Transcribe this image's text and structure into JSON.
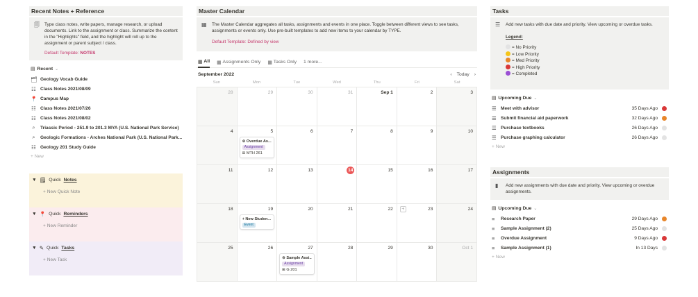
{
  "colors": {
    "none": "#e3e3e3",
    "low": "#f5c518",
    "med": "#e8862a",
    "high": "#d93838",
    "completed": "#9b4fd4",
    "today": "#eb5757",
    "notes_bg": "#fbf3db",
    "reminders_bg": "#fbecee",
    "tasks_bg": "#f1ecf7"
  },
  "left": {
    "title": "Recent Notes + Reference",
    "callout_icon": "note-icon",
    "callout_text": "Type class notes, write papers, manage research, or upload documents. Link to the assignment or class. Summarize the content in the \"Highlights\" field, and the highlight will roll up to the assignment or parent subject / class.",
    "template_label": "Default Template:",
    "template_value": "NOTES",
    "view": "Recent",
    "items": [
      {
        "icon": "card-icon",
        "label": "Geology Vocab Guide"
      },
      {
        "icon": "page-icon",
        "label": "Class Notes 2021/08/09"
      },
      {
        "icon": "pin-icon",
        "label": "Campus Map"
      },
      {
        "icon": "page-icon",
        "label": "Class Notes 2021/07/26"
      },
      {
        "icon": "page-icon",
        "label": "Class Notes 2021/08/02"
      },
      {
        "icon": "search-icon",
        "label": "Triassic Period - 251.9 to 201.3 MYA (U.S. National Park Service)"
      },
      {
        "icon": "search-icon",
        "label": "Geologic Formations - Arches National Park (U.S. National Park..."
      },
      {
        "icon": "page-icon",
        "label": "Geology 201 Study Guide"
      }
    ],
    "new_label": "New",
    "quick": [
      {
        "prefix": "Quick",
        "word": "Notes",
        "icon": "notepad-icon",
        "new": "New Quick Note"
      },
      {
        "prefix": "Quick",
        "word": "Reminders",
        "icon": "pin-icon",
        "new": "New Reminder"
      },
      {
        "prefix": "Quick",
        "word": "Tasks",
        "icon": "pencil-icon",
        "new": "New Task"
      }
    ]
  },
  "mid": {
    "title": "Master Calendar",
    "callout_text": "The Master Calendar aggregates all tasks, assignments and events in one place. Toggle between different views to see tasks, assignments or events only. Use pre-built templates to add new items to your calendar by TYPE.",
    "template_text": "Default Template: Defined by view",
    "tabs": [
      "All",
      "Assignments Only",
      "Tasks Only",
      "1 more..."
    ],
    "month": "September 2022",
    "today_label": "Today",
    "dows": [
      "Sun",
      "Mon",
      "Tue",
      "Wed",
      "Thu",
      "Fri",
      "Sat"
    ],
    "weeks": [
      [
        "28",
        "29",
        "30",
        "31",
        "Sep 1",
        "2",
        "3"
      ],
      [
        "4",
        "5",
        "6",
        "7",
        "8",
        "9",
        "10"
      ],
      [
        "11",
        "12",
        "13",
        "14",
        "15",
        "16",
        "17"
      ],
      [
        "18",
        "19",
        "20",
        "21",
        "22",
        "23",
        "24"
      ],
      [
        "25",
        "26",
        "27",
        "28",
        "29",
        "30",
        "Oct 1"
      ]
    ],
    "events": {
      "overdue": {
        "title": "Overdue As...",
        "tag": "Assignment",
        "course": "MTH 261"
      },
      "student": {
        "title": "+ New Studen...",
        "tag": "Event"
      },
      "sample": {
        "title": "Sample Assi...",
        "tag": "Assignment",
        "course": "G 201"
      }
    }
  },
  "right": {
    "tasks_title": "Tasks",
    "tasks_callout": "Add new tasks with due date and priority. View upcoming or overdue tasks.",
    "legend_title": "Legend:",
    "legend": [
      "= No Priority",
      "= Low Priority",
      "= Med Priority",
      "= High Priority",
      "= Completed"
    ],
    "upcoming_view": "Upcoming Due",
    "tasks": [
      {
        "name": "Meet with advisor",
        "due": "35 Days Ago",
        "prio": "high"
      },
      {
        "name": "Submit financial aid paperwork",
        "due": "32 Days Ago",
        "prio": "med"
      },
      {
        "name": "Purchase textbooks",
        "due": "26 Days Ago",
        "prio": "none"
      },
      {
        "name": "Purchase graphing calculator",
        "due": "26 Days Ago",
        "prio": "none"
      }
    ],
    "new_label": "New",
    "assign_title": "Assignments",
    "assign_callout": "Add new assignments with due date and priority. View upcoming or overdue assignments.",
    "assign_view": "Upcoming Due",
    "assignments": [
      {
        "name": "Research Paper",
        "due": "29 Days Ago",
        "prio": "med"
      },
      {
        "name": "Sample Assignment (2)",
        "due": "25 Days Ago",
        "prio": "none"
      },
      {
        "name": "Overdue Assignment",
        "due": "9 Days Ago",
        "prio": "high"
      },
      {
        "name": "Sample Assignment (1)",
        "due": "In 13 Days",
        "prio": "none"
      }
    ]
  }
}
